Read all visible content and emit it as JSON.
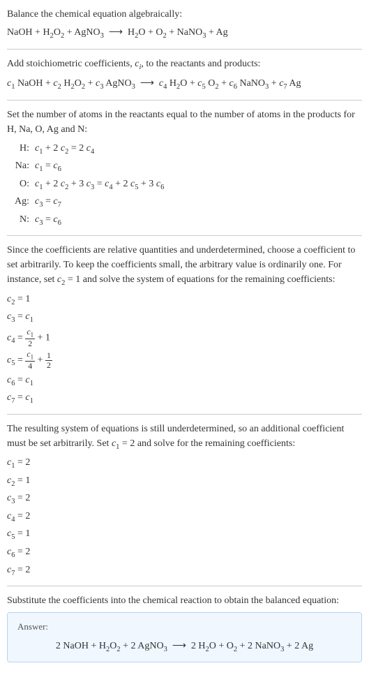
{
  "section1": {
    "text": "Balance the chemical equation algebraically:",
    "equation": "NaOH + H₂O₂ + AgNO₃  ⟶  H₂O + O₂ + NaNO₃ + Ag"
  },
  "section2": {
    "text_before": "Add stoichiometric coefficients, ",
    "ci": "cᵢ",
    "text_after": ", to the reactants and products:",
    "equation": "c₁ NaOH + c₂ H₂O₂ + c₃ AgNO₃  ⟶  c₄ H₂O + c₅ O₂ + c₆ NaNO₃ + c₇ Ag"
  },
  "section3": {
    "text": "Set the number of atoms in the reactants equal to the number of atoms in the products for H, Na, O, Ag and N:",
    "rows": [
      {
        "label": "H:",
        "eq": "c₁ + 2 c₂ = 2 c₄"
      },
      {
        "label": "Na:",
        "eq": "c₁ = c₆"
      },
      {
        "label": "O:",
        "eq": "c₁ + 2 c₂ + 3 c₃ = c₄ + 2 c₅ + 3 c₆"
      },
      {
        "label": "Ag:",
        "eq": "c₃ = c₇"
      },
      {
        "label": "N:",
        "eq": "c₃ = c₆"
      }
    ]
  },
  "section4": {
    "text": "Since the coefficients are relative quantities and underdetermined, choose a coefficient to set arbitrarily. To keep the coefficients small, the arbitrary value is ordinarily one. For instance, set c₂ = 1 and solve the system of equations for the remaining coefficients:",
    "coeffs": [
      "c₂ = 1",
      "c₃ = c₁"
    ],
    "c4_prefix": "c₄ = ",
    "c4_num": "c₁",
    "c4_den": "2",
    "c4_suffix": " + 1",
    "c5_prefix": "c₅ = ",
    "c5_num1": "c₁",
    "c5_den1": "4",
    "c5_mid": " + ",
    "c5_num2": "1",
    "c5_den2": "2",
    "coeffs_after": [
      "c₆ = c₁",
      "c₇ = c₁"
    ]
  },
  "section5": {
    "text": "The resulting system of equations is still underdetermined, so an additional coefficient must be set arbitrarily. Set c₁ = 2 and solve for the remaining coefficients:",
    "coeffs": [
      "c₁ = 2",
      "c₂ = 1",
      "c₃ = 2",
      "c₄ = 2",
      "c₅ = 1",
      "c₆ = 2",
      "c₇ = 2"
    ]
  },
  "section6": {
    "text": "Substitute the coefficients into the chemical reaction to obtain the balanced equation:",
    "answer_label": "Answer:",
    "answer_eq": "2 NaOH + H₂O₂ + 2 AgNO₃  ⟶  2 H₂O + O₂ + 2 NaNO₃ + 2 Ag"
  }
}
